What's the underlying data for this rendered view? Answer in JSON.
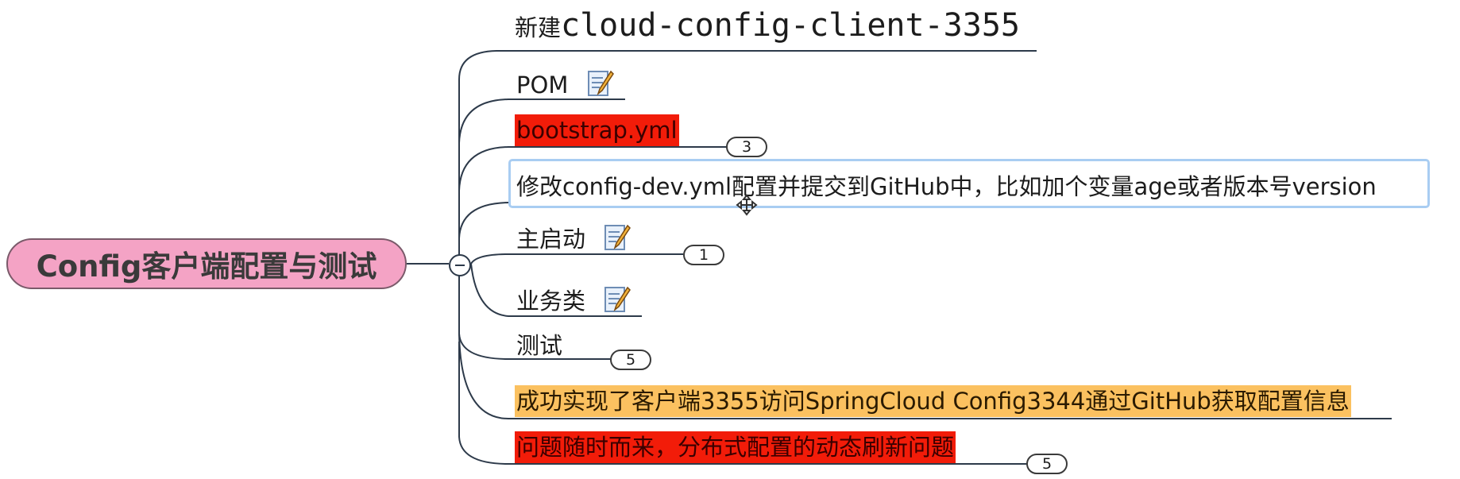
{
  "mindmap": {
    "root": {
      "label": "Config客户端配置与测试",
      "fill": "#f4a3c5"
    },
    "branches": [
      {
        "id": "new-module",
        "prefix": "新建",
        "label": "cloud-config-client-3355"
      },
      {
        "id": "pom",
        "label": "POM",
        "icon": "edit-note-icon"
      },
      {
        "id": "bootstrap",
        "label": "bootstrap.yml",
        "highlight": "#f21c09",
        "badge": "3"
      },
      {
        "id": "modify-config",
        "label": "修改config-dev.yml配置并提交到GitHub中，比如加个变量age或者版本号version",
        "selected": true
      },
      {
        "id": "main-start",
        "label": "主启动",
        "icon": "edit-note-icon",
        "badge": "1"
      },
      {
        "id": "business",
        "label": "业务类",
        "icon": "edit-note-icon"
      },
      {
        "id": "test",
        "label": "测试",
        "badge": "5"
      },
      {
        "id": "success",
        "label": "成功实现了客户端3355访问SpringCloud Config3344通过GitHub获取配置信息",
        "highlight": "#fbc160"
      },
      {
        "id": "problem",
        "label": "问题随时而来，分布式配置的动态刷新问题",
        "highlight": "#f21c09",
        "badge": "5"
      }
    ]
  }
}
